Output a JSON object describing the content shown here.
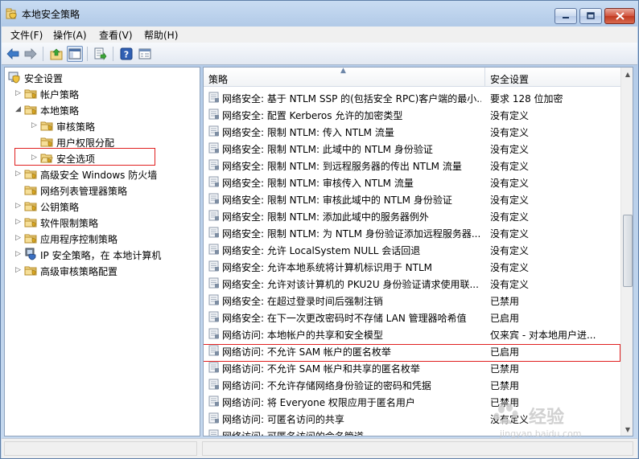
{
  "window": {
    "title": "本地安全策略"
  },
  "menu": {
    "items": [
      "文件(F)",
      "操作(A)",
      "查看(V)",
      "帮助(H)"
    ]
  },
  "toolbar": {
    "buttons": [
      "back-arrow-icon",
      "forward-arrow-icon",
      "up-folder-icon",
      "show-hide-tree-icon",
      "export-list-icon",
      "help-icon",
      "properties-icon"
    ]
  },
  "tree": {
    "items": [
      {
        "label": "安全设置",
        "level": 0,
        "expanded": true,
        "icon": "computer-shield-icon"
      },
      {
        "label": "帐户策略",
        "level": 1,
        "expanded": false,
        "icon": "folder-icon"
      },
      {
        "label": "本地策略",
        "level": 1,
        "expanded": true,
        "icon": "folder-icon"
      },
      {
        "label": "审核策略",
        "level": 2,
        "expanded": false,
        "icon": "folder-icon"
      },
      {
        "label": "用户权限分配",
        "level": 2,
        "expanded": null,
        "icon": "folder-icon"
      },
      {
        "label": "安全选项",
        "level": 2,
        "expanded": false,
        "icon": "folder-open-icon",
        "selected": true
      },
      {
        "label": "高级安全 Windows 防火墙",
        "level": 1,
        "expanded": false,
        "icon": "folder-icon"
      },
      {
        "label": "网络列表管理器策略",
        "level": 1,
        "expanded": null,
        "icon": "folder-icon"
      },
      {
        "label": "公钥策略",
        "level": 1,
        "expanded": false,
        "icon": "folder-icon"
      },
      {
        "label": "软件限制策略",
        "level": 1,
        "expanded": false,
        "icon": "folder-icon"
      },
      {
        "label": "应用程序控制策略",
        "level": 1,
        "expanded": false,
        "icon": "folder-icon"
      },
      {
        "label": "IP 安全策略，在 本地计算机",
        "level": 1,
        "expanded": false,
        "icon": "ip-security-icon"
      },
      {
        "label": "高级审核策略配置",
        "level": 1,
        "expanded": false,
        "icon": "folder-icon"
      }
    ]
  },
  "list": {
    "columns": [
      "策略",
      "安全设置"
    ],
    "rows": [
      {
        "name": "网络安全: 基于 NTLM SSP 的(包括安全 RPC)客户端的最小...",
        "value": "要求 128 位加密"
      },
      {
        "name": "网络安全: 配置 Kerberos 允许的加密类型",
        "value": "没有定义"
      },
      {
        "name": "网络安全: 限制 NTLM: 传入 NTLM 流量",
        "value": "没有定义"
      },
      {
        "name": "网络安全: 限制 NTLM: 此域中的 NTLM 身份验证",
        "value": "没有定义"
      },
      {
        "name": "网络安全: 限制 NTLM: 到远程服务器的传出 NTLM 流量",
        "value": "没有定义"
      },
      {
        "name": "网络安全: 限制 NTLM: 审核传入 NTLM 流量",
        "value": "没有定义"
      },
      {
        "name": "网络安全: 限制 NTLM: 审核此域中的 NTLM 身份验证",
        "value": "没有定义"
      },
      {
        "name": "网络安全: 限制 NTLM: 添加此域中的服务器例外",
        "value": "没有定义"
      },
      {
        "name": "网络安全: 限制 NTLM: 为 NTLM 身份验证添加远程服务器...",
        "value": "没有定义"
      },
      {
        "name": "网络安全: 允许 LocalSystem NULL 会话回退",
        "value": "没有定义"
      },
      {
        "name": "网络安全: 允许本地系统将计算机标识用于 NTLM",
        "value": "没有定义"
      },
      {
        "name": "网络安全: 允许对该计算机的 PKU2U 身份验证请求使用联...",
        "value": "没有定义"
      },
      {
        "name": "网络安全: 在超过登录时间后强制注销",
        "value": "已禁用"
      },
      {
        "name": "网络安全: 在下一次更改密码时不存储 LAN 管理器哈希值",
        "value": "已启用"
      },
      {
        "name": "网络访问: 本地帐户的共享和安全模型",
        "value": "仅来宾 - 对本地用户进...",
        "highlighted": true
      },
      {
        "name": "网络访问: 不允许 SAM 帐户的匿名枚举",
        "value": "已启用"
      },
      {
        "name": "网络访问: 不允许 SAM 帐户和共享的匿名枚举",
        "value": "已禁用"
      },
      {
        "name": "网络访问: 不允许存储网络身份验证的密码和凭据",
        "value": "已禁用"
      },
      {
        "name": "网络访问: 将 Everyone 权限应用于匿名用户",
        "value": "已禁用"
      },
      {
        "name": "网络访问: 可匿名访问的共享",
        "value": "没有定义"
      },
      {
        "name": "网络访问: 可匿名访问的命名管道",
        "value": ""
      }
    ]
  },
  "watermark": {
    "brand": "经验",
    "url": "jingyan.baidu.com"
  }
}
